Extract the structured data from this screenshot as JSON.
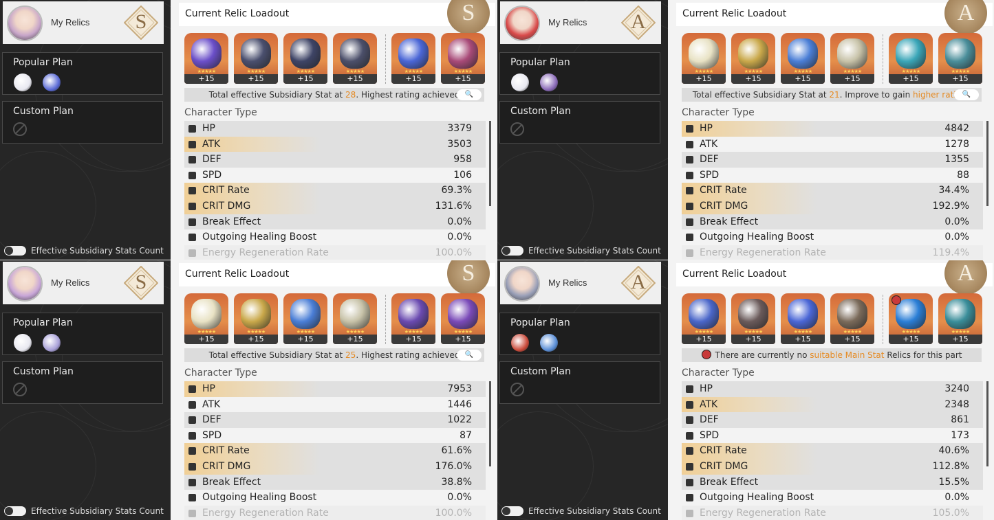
{
  "panels": [
    {
      "side": {
        "title": "My Relics",
        "rank": "S",
        "avatar_color": "#c7a5c9",
        "popular_plan": "Popular Plan",
        "custom_plan": "Custom Plan",
        "toggle_label": "Effective Subsidiary Stats Count"
      },
      "main": {
        "title": "Current Relic Loadout",
        "rank": "S",
        "relics": [
          {
            "level": "+15",
            "color": "#6b4fc9"
          },
          {
            "level": "+15",
            "color": "#4a4f6e"
          },
          {
            "level": "+15",
            "color": "#3e4466"
          },
          {
            "level": "+15",
            "color": "#4b4f6a"
          },
          {
            "level": "+15",
            "color": "#4a66d6"
          },
          {
            "level": "+15",
            "color": "#a84a78"
          }
        ],
        "eff_prefix": "Total effective Subsidiary Stat at ",
        "eff_value": "28",
        "eff_suffix": ". Highest rating achieved",
        "character_type": "Character Type",
        "stats": [
          {
            "name": "HP",
            "value": "3379"
          },
          {
            "name": "ATK",
            "value": "3503"
          },
          {
            "name": "DEF",
            "value": "958"
          },
          {
            "name": "SPD",
            "value": "106"
          },
          {
            "name": "CRIT Rate",
            "value": "69.3%"
          },
          {
            "name": "CRIT DMG",
            "value": "131.6%"
          },
          {
            "name": "Break Effect",
            "value": "0.0%"
          },
          {
            "name": "Outgoing Healing Boost",
            "value": "0.0%"
          },
          {
            "name": "Energy Regeneration Rate",
            "value": "100.0%"
          }
        ]
      }
    },
    {
      "side": {
        "title": "My Relics",
        "rank": "A",
        "avatar_color": "#d94a4a",
        "popular_plan": "Popular Plan",
        "custom_plan": "Custom Plan",
        "toggle_label": "Effective Subsidiary Stats Count"
      },
      "main": {
        "title": "Current Relic Loadout",
        "rank": "A",
        "relics": [
          {
            "level": "+15",
            "color": "#e8e2c4"
          },
          {
            "level": "+15",
            "color": "#c9a84a"
          },
          {
            "level": "+15",
            "color": "#4a7ed6"
          },
          {
            "level": "+15",
            "color": "#c7c2a8"
          },
          {
            "level": "+15",
            "color": "#3aa6b8"
          },
          {
            "level": "+15",
            "color": "#4a8e9a"
          }
        ],
        "eff_prefix": "Total effective Subsidiary Stat at ",
        "eff_value": "21",
        "eff_suffix": ". Improve to gain ",
        "eff_link": "higher ratings",
        "character_type": "Character Type",
        "stats": [
          {
            "name": "HP",
            "value": "4842"
          },
          {
            "name": "ATK",
            "value": "1278"
          },
          {
            "name": "DEF",
            "value": "1355"
          },
          {
            "name": "SPD",
            "value": "88"
          },
          {
            "name": "CRIT Rate",
            "value": "34.4%"
          },
          {
            "name": "CRIT DMG",
            "value": "192.9%"
          },
          {
            "name": "Break Effect",
            "value": "0.0%"
          },
          {
            "name": "Outgoing Healing Boost",
            "value": "0.0%"
          },
          {
            "name": "Energy Regeneration Rate",
            "value": "119.4%"
          }
        ]
      }
    },
    {
      "side": {
        "title": "My Relics",
        "rank": "S",
        "avatar_color": "#c8a6d8",
        "popular_plan": "Popular Plan",
        "custom_plan": "Custom Plan",
        "toggle_label": "Effective Subsidiary Stats Count"
      },
      "main": {
        "title": "Current Relic Loadout",
        "rank": "S",
        "relics": [
          {
            "level": "+15",
            "color": "#e8e2c4"
          },
          {
            "level": "+15",
            "color": "#c9a84a"
          },
          {
            "level": "+15",
            "color": "#4a7ed6"
          },
          {
            "level": "+15",
            "color": "#c7c2a8"
          },
          {
            "level": "+15",
            "color": "#6a4ab0"
          },
          {
            "level": "+15",
            "color": "#7a4ab8"
          }
        ],
        "eff_prefix": "Total effective Subsidiary Stat at ",
        "eff_value": "25",
        "eff_suffix": ". Highest rating achieved",
        "character_type": "Character Type",
        "stats": [
          {
            "name": "HP",
            "value": "7953"
          },
          {
            "name": "ATK",
            "value": "1446"
          },
          {
            "name": "DEF",
            "value": "1022"
          },
          {
            "name": "SPD",
            "value": "87"
          },
          {
            "name": "CRIT Rate",
            "value": "61.6%"
          },
          {
            "name": "CRIT DMG",
            "value": "176.0%"
          },
          {
            "name": "Break Effect",
            "value": "38.8%"
          },
          {
            "name": "Outgoing Healing Boost",
            "value": "0.0%"
          },
          {
            "name": "Energy Regeneration Rate",
            "value": "100.0%"
          }
        ]
      }
    },
    {
      "side": {
        "title": "My Relics",
        "rank": "A",
        "avatar_color": "#9aa0b8",
        "popular_plan": "Popular Plan",
        "custom_plan": "Custom Plan",
        "toggle_label": "Effective Subsidiary Stats Count"
      },
      "main": {
        "title": "Current Relic Loadout",
        "rank": "A",
        "relics": [
          {
            "level": "+15",
            "color": "#4a66c9"
          },
          {
            "level": "+15",
            "color": "#6a5a5a"
          },
          {
            "level": "+15",
            "color": "#4a66d6"
          },
          {
            "level": "+15",
            "color": "#7a6a5a"
          },
          {
            "level": "+15",
            "color": "#2a7ed6",
            "warning": true
          },
          {
            "level": "+15",
            "color": "#3a8e9a"
          }
        ],
        "eff_prefix": "There are currently no ",
        "eff_value": "suitable Main Stat",
        "eff_suffix": " Relics for this part",
        "warning": true,
        "character_type": "Character Type",
        "stats": [
          {
            "name": "HP",
            "value": "3240"
          },
          {
            "name": "ATK",
            "value": "2348"
          },
          {
            "name": "DEF",
            "value": "861"
          },
          {
            "name": "SPD",
            "value": "173"
          },
          {
            "name": "CRIT Rate",
            "value": "40.6%"
          },
          {
            "name": "CRIT DMG",
            "value": "112.8%"
          },
          {
            "name": "Break Effect",
            "value": "15.5%"
          },
          {
            "name": "Outgoing Healing Boost",
            "value": "0.0%"
          },
          {
            "name": "Energy Regeneration Rate",
            "value": "105.0%"
          }
        ]
      }
    }
  ],
  "highlight_rows": [
    [
      1,
      4,
      5
    ],
    [
      0,
      4,
      5
    ],
    [
      0,
      4,
      5
    ],
    [
      1,
      4,
      5
    ]
  ],
  "popular_relic_colors": [
    [
      "#e8e8f0",
      "#5a6ad6"
    ],
    [
      "#e8e8f0",
      "#8a6ab8"
    ],
    [
      "#e8e8f0",
      "#a8a0d8"
    ],
    [
      "#c94a3a",
      "#5a8ed6"
    ]
  ],
  "accent_color": "#e58a23"
}
